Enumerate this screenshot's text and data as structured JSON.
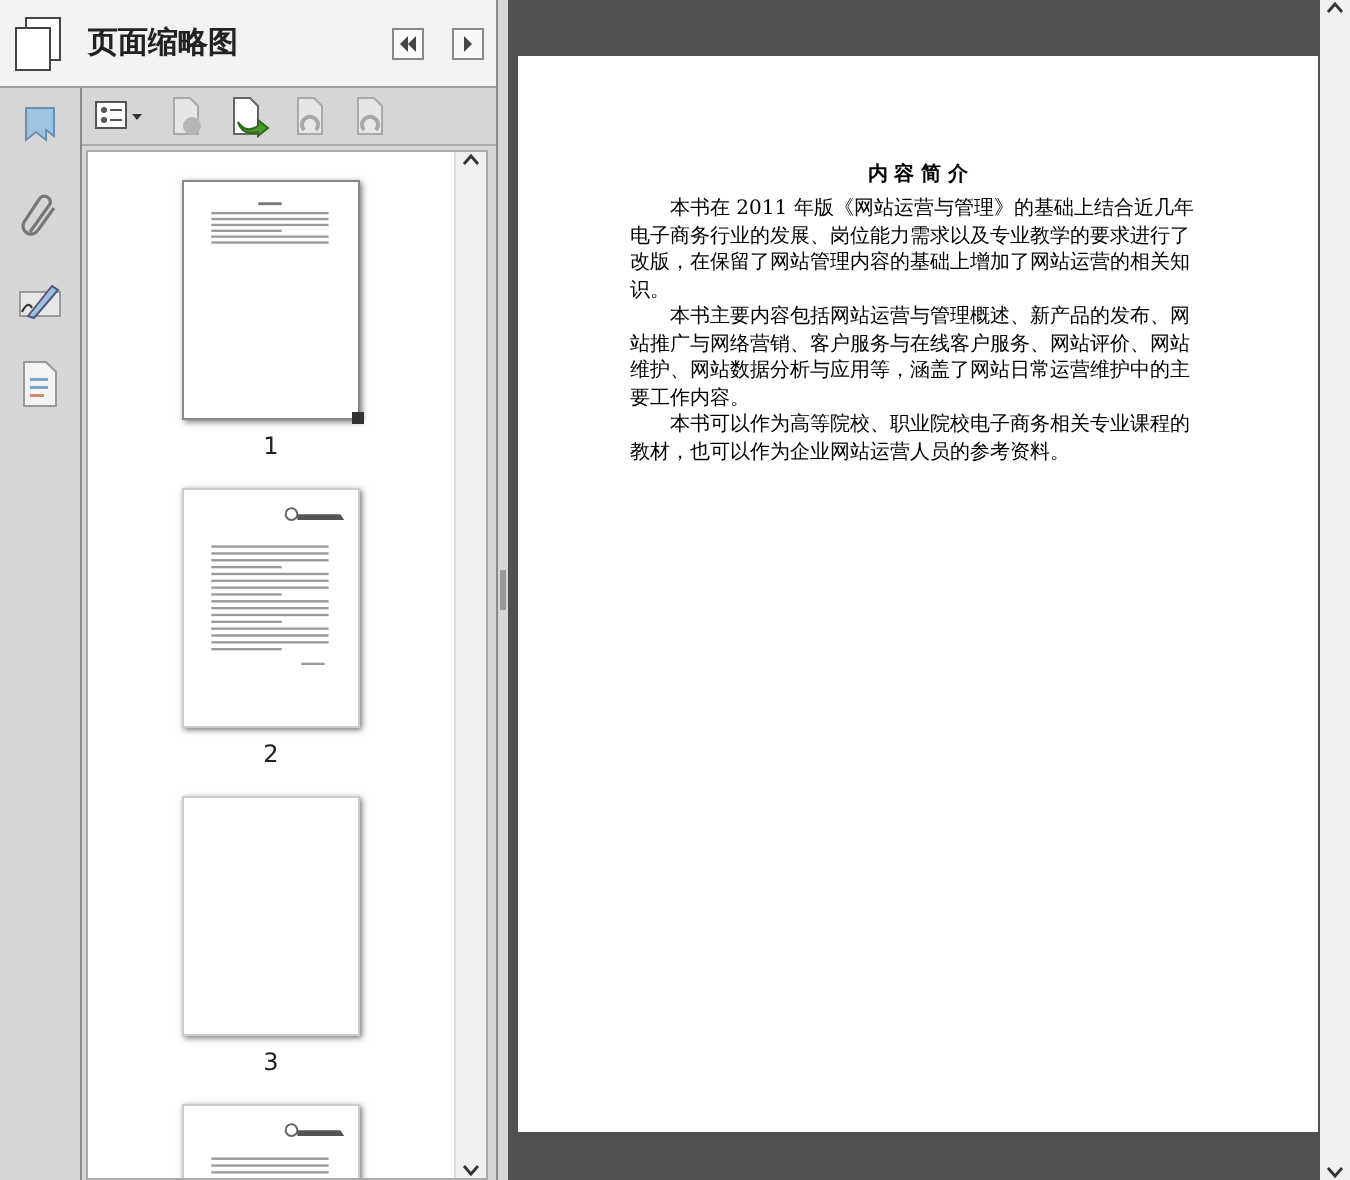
{
  "panel": {
    "title": "页面缩略图"
  },
  "toolbar": [
    {
      "kind": "options",
      "disabled": false
    },
    {
      "kind": "delete",
      "disabled": true
    },
    {
      "kind": "insert",
      "disabled": false
    },
    {
      "kind": "rotate-left",
      "disabled": true
    },
    {
      "kind": "rotate-right",
      "disabled": true
    }
  ],
  "rail": [
    {
      "kind": "bookmark"
    },
    {
      "kind": "attachment"
    },
    {
      "kind": "signature"
    },
    {
      "kind": "pages"
    }
  ],
  "thumbnails": [
    {
      "kind": "intro",
      "label": "1",
      "selected": true
    },
    {
      "kind": "letter",
      "label": "2",
      "selected": false
    },
    {
      "kind": "blank",
      "label": "3",
      "selected": false
    },
    {
      "kind": "contents"
    }
  ],
  "page": {
    "title": "内 容 简 介",
    "paragraphs": [
      "本书在 2011 年版《网站运营与管理》的基础上结合近几年电子商务行业的发展、岗位能力需求以及专业教学的要求进行了改版，在保留了网站管理内容的基础上增加了网站运营的相关知识。",
      "本书主要内容包括网站运营与管理概述、新产品的发布、网站推广与网络营销、客户服务与在线客户服务、网站评价、网站维护、网站数据分析与应用等，涵盖了网站日常运营维护中的主要工作内容。",
      "本书可以作为高等院校、职业院校电子商务相关专业课程的教材，也可以作为企业网站运营人员的参考资料。"
    ]
  }
}
